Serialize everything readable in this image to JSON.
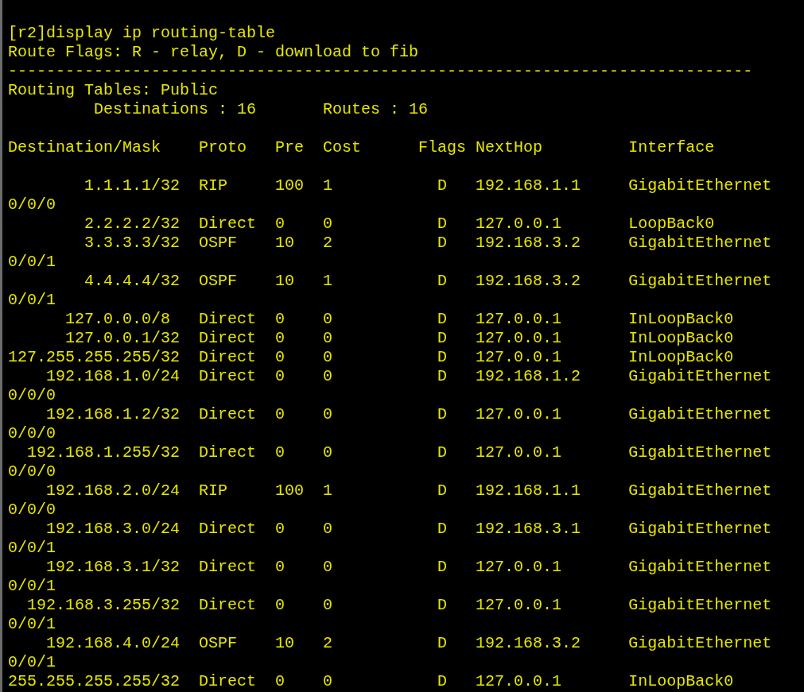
{
  "terminal": {
    "blocks": [
      [
        "[r2]display ip routing-table",
        "Route Flags: R - relay, D - download to fib",
        "------------------------------------------------------------------------------",
        "Routing Tables: Public",
        "         Destinations : 16       Routes : 16"
      ],
      [
        "Destination/Mask    Proto   Pre  Cost      Flags NextHop         Interface"
      ],
      [
        "        1.1.1.1/32  RIP     100  1           D   192.168.1.1     GigabitEthernet",
        "0/0/0",
        "        2.2.2.2/32  Direct  0    0           D   127.0.0.1       LoopBack0",
        "        3.3.3.3/32  OSPF    10   2           D   192.168.3.2     GigabitEthernet",
        "0/0/1",
        "        4.4.4.4/32  OSPF    10   1           D   192.168.3.2     GigabitEthernet",
        "0/0/1",
        "      127.0.0.0/8   Direct  0    0           D   127.0.0.1       InLoopBack0",
        "      127.0.0.1/32  Direct  0    0           D   127.0.0.1       InLoopBack0",
        "127.255.255.255/32  Direct  0    0           D   127.0.0.1       InLoopBack0",
        "    192.168.1.0/24  Direct  0    0           D   192.168.1.2     GigabitEthernet",
        "0/0/0",
        "    192.168.1.2/32  Direct  0    0           D   127.0.0.1       GigabitEthernet",
        "0/0/0",
        "  192.168.1.255/32  Direct  0    0           D   127.0.0.1       GigabitEthernet",
        "0/0/0",
        "    192.168.2.0/24  RIP     100  1           D   192.168.1.1     GigabitEthernet",
        "0/0/0",
        "    192.168.3.0/24  Direct  0    0           D   192.168.3.1     GigabitEthernet",
        "0/0/1",
        "    192.168.3.1/32  Direct  0    0           D   127.0.0.1       GigabitEthernet",
        "0/0/1",
        "  192.168.3.255/32  Direct  0    0           D   127.0.0.1       GigabitEthernet",
        "0/0/1",
        "    192.168.4.0/24  OSPF    10   2           D   192.168.3.2     GigabitEthernet",
        "0/0/1",
        "255.255.255.255/32  Direct  0    0           D   127.0.0.1       InLoopBack0"
      ]
    ]
  }
}
